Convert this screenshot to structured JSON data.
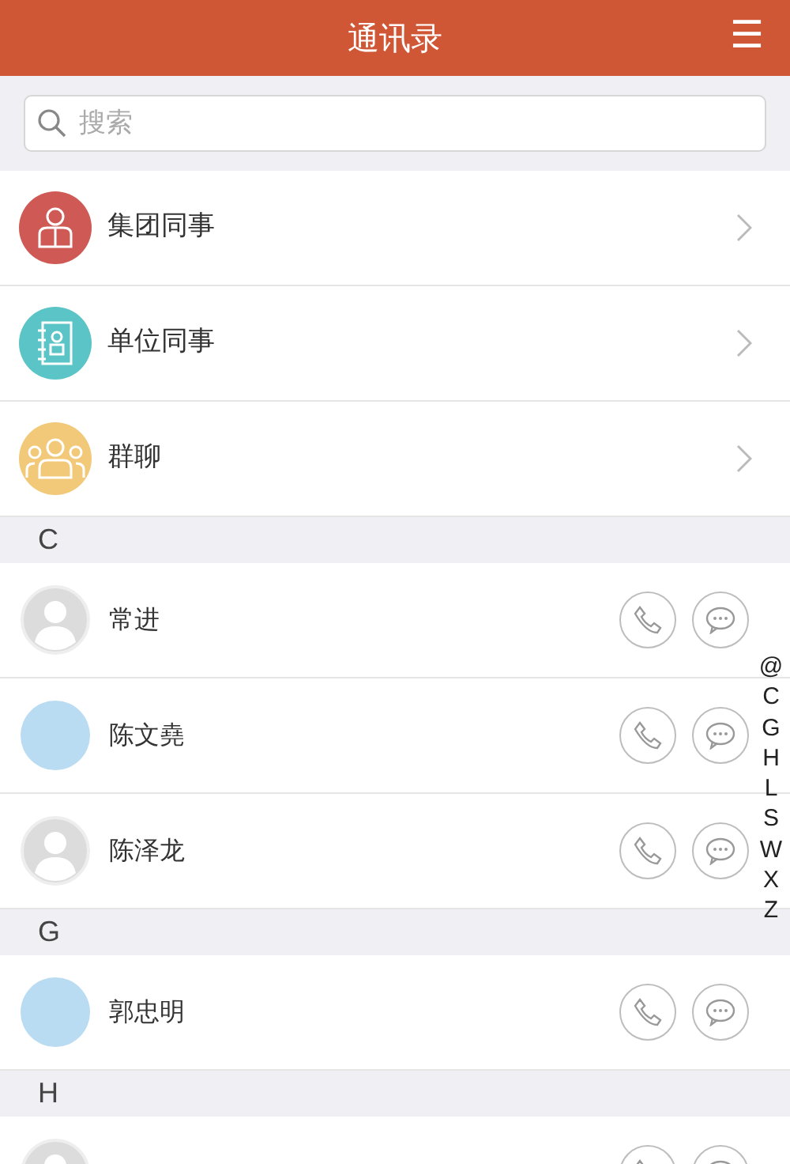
{
  "header": {
    "title": "通讯录",
    "menu_glyph": "☰"
  },
  "search": {
    "placeholder": "搜索"
  },
  "groups": [
    {
      "label": "集团同事",
      "color": "#cf5a55",
      "kind": "person"
    },
    {
      "label": "单位同事",
      "color": "#5bc4c6",
      "kind": "book"
    },
    {
      "label": "群聊",
      "color": "#f2c978",
      "kind": "people"
    }
  ],
  "sections": [
    {
      "letter": "C",
      "contacts": [
        {
          "name": "常进",
          "photo": false
        },
        {
          "name": "陈文堯",
          "photo": true
        },
        {
          "name": "陈泽龙",
          "photo": false
        }
      ]
    },
    {
      "letter": "G",
      "contacts": [
        {
          "name": "郭忠明",
          "photo": true
        }
      ]
    },
    {
      "letter": "H",
      "contacts": [
        {
          "photo": false
        }
      ]
    }
  ],
  "index": [
    "@",
    "C",
    "G",
    "H",
    "L",
    "S",
    "W",
    "X",
    "Z"
  ]
}
